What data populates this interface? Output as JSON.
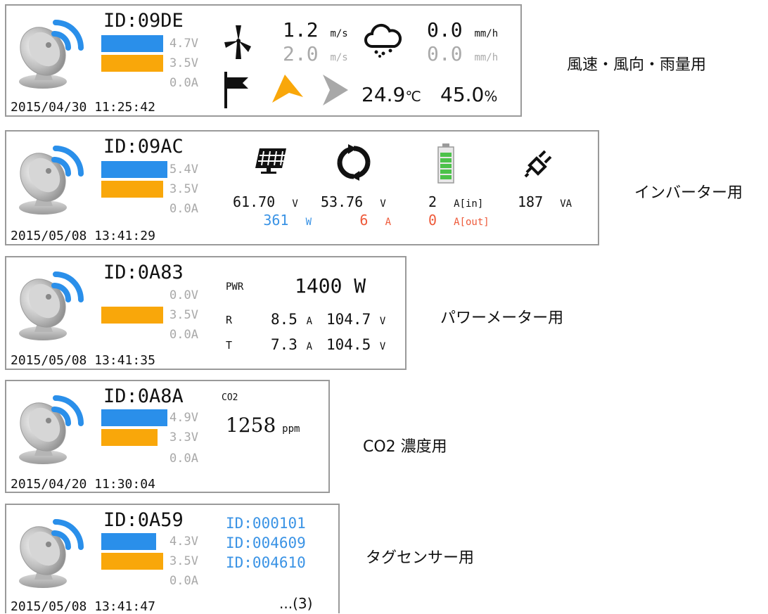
{
  "colors": {
    "bar_blue": "#2a8fea",
    "bar_orange": "#f9a70a",
    "blue_text": "#3a93e5",
    "red_text": "#ee5a3a",
    "gray_text": "#aaa"
  },
  "cards": [
    {
      "id": "ID:09DE",
      "v1": "4.7V",
      "v2": "3.5V",
      "amp": "0.0A",
      "date": "2015/04/30 11:25:42",
      "caption": "風速・風向・雨量用",
      "wind_now": "1.2",
      "wind_max": "2.0",
      "wind_unit": "m/s",
      "rain_now": "0.0",
      "rain_max": "0.0",
      "rain_unit": "mm/h",
      "temp": "24.9",
      "temp_unit": "℃",
      "humidity": "45.0",
      "hum_unit": "%",
      "icons": [
        "windmill-icon",
        "flag-icon",
        "wind-direction-arrow-icon",
        "wind-direction-max-arrow-icon",
        "rain-cloud-icon"
      ]
    },
    {
      "id": "ID:09AC",
      "v1": "5.4V",
      "v2": "3.5V",
      "amp": "0.0A",
      "date": "2015/05/08 13:41:29",
      "caption": "インバーター用",
      "solar_v": "61.70",
      "solar_w": "361",
      "cycle_v": "53.76",
      "cycle_a": "6",
      "batt_in": "2",
      "batt_out": "0",
      "load_va": "187",
      "u_v": "V",
      "u_w": "W",
      "u_a": "A",
      "u_ain": "A[in]",
      "u_aout": "A[out]",
      "u_va": "VA",
      "icons": [
        "solar-panel-icon",
        "refresh-cycle-icon",
        "battery-icon",
        "plug-icon"
      ]
    },
    {
      "id": "ID:0A83",
      "v1": "0.0V",
      "v2": "3.5V",
      "amp": "0.0A",
      "date": "2015/05/08 13:41:35",
      "caption": "パワーメーター用",
      "pwr_label": "PWR",
      "pwr": "1400",
      "pwr_unit": "W",
      "r_label": "R",
      "r_a": "8.5",
      "r_v": "104.7",
      "t_label": "T",
      "t_a": "7.3",
      "t_v": "104.5",
      "u_a": "A",
      "u_v": "V"
    },
    {
      "id": "ID:0A8A",
      "v1": "4.9V",
      "v2": "3.3V",
      "amp": "0.0A",
      "date": "2015/04/20 11:30:04",
      "caption": "CO2 濃度用",
      "co2_label": "CO2",
      "co2": "1258",
      "co2_unit": "ppm"
    },
    {
      "id": "ID:0A59",
      "v1": "4.3V",
      "v2": "3.5V",
      "amp": "0.0A",
      "date": "2015/05/08 13:41:47",
      "caption": "タグセンサー用",
      "tags": [
        "ID:000101",
        "ID:004609",
        "ID:004610"
      ],
      "more": "...(3)"
    }
  ]
}
